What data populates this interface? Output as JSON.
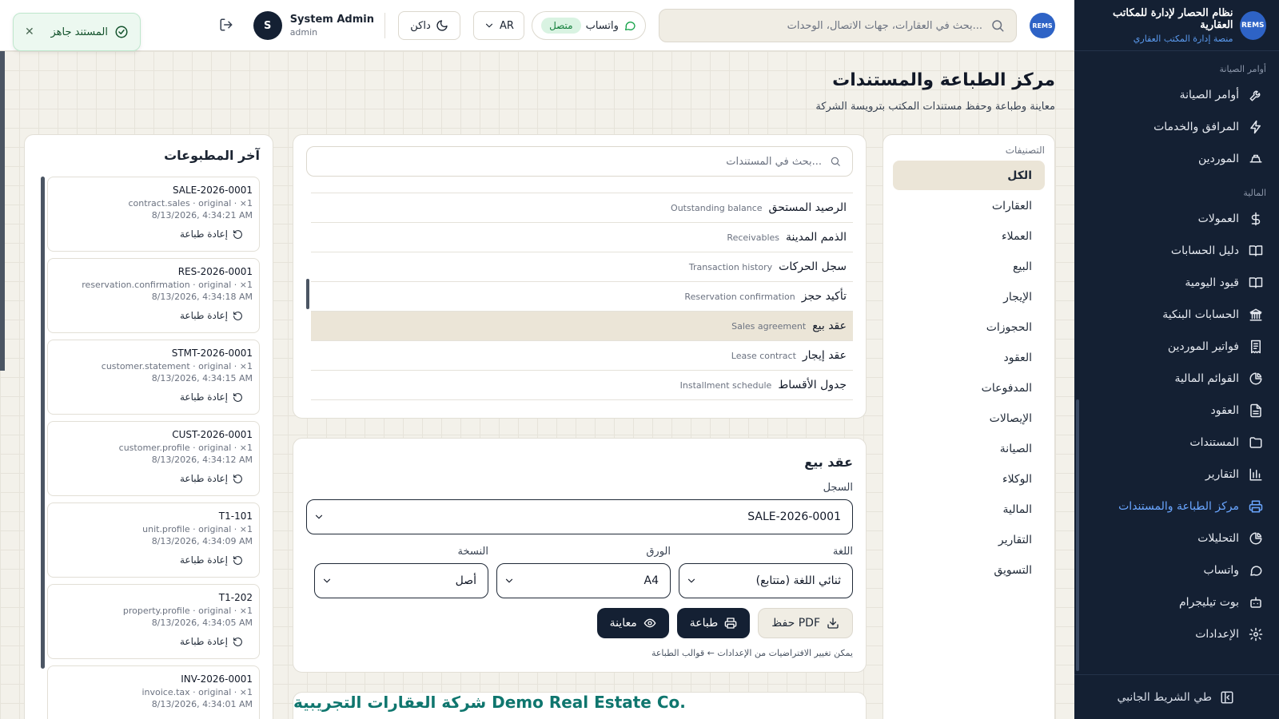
{
  "sidebar": {
    "brand_name": "نظام الحصار لإدارة للمكاتب العقارية",
    "brand_sub": "منصة إدارة المكتب العقاري",
    "logo_text": "REMS",
    "groups": [
      {
        "label": "أوامر الصيانة",
        "items": [
          {
            "label": "أوامر الصيانة",
            "icon": "wrench-icon"
          },
          {
            "label": "المرافق والخدمات",
            "icon": "zap-icon"
          },
          {
            "label": "الموردين",
            "icon": "truck-icon"
          }
        ]
      },
      {
        "label": "المالية",
        "items": [
          {
            "label": "العمولات",
            "icon": "dollar-icon"
          },
          {
            "label": "دليل الحسابات",
            "icon": "book-icon"
          },
          {
            "label": "قيود اليومية",
            "icon": "book-open-icon"
          },
          {
            "label": "الحسابات البنكية",
            "icon": "bank-icon"
          },
          {
            "label": "فواتير الموردين",
            "icon": "receipt-icon"
          },
          {
            "label": "القوائم المالية",
            "icon": "pie-icon"
          },
          {
            "label": "العقود",
            "icon": "file-icon"
          },
          {
            "label": "المستندات",
            "icon": "folder-icon"
          },
          {
            "label": "التقارير",
            "icon": "bar-chart-icon"
          },
          {
            "label": "مركز الطباعة والمستندات",
            "icon": "printer-icon",
            "active": true
          },
          {
            "label": "التحليلات",
            "icon": "pie-icon"
          },
          {
            "label": "واتساب",
            "icon": "message-icon"
          },
          {
            "label": "بوت تيليجرام",
            "icon": "bot-icon"
          },
          {
            "label": "الإعدادات",
            "icon": "gear-icon"
          }
        ]
      }
    ],
    "collapse_label": "طي الشريط الجانبي"
  },
  "topbar": {
    "search_placeholder": "بحث في العقارات، جهات الاتصال، الوحدات...",
    "avatar_text": "REMS",
    "whatsapp_label": "واتساب",
    "whatsapp_status": "متصل",
    "lang_label": "AR",
    "theme_label": "داكن",
    "user_initial": "S",
    "user_name": "System Admin",
    "user_role": "admin"
  },
  "toast": {
    "message": "المستند جاهز"
  },
  "page": {
    "title": "مركز الطباعة والمستندات",
    "subtitle": "معاينة وطباعة وحفظ مستندات المكتب بترويسة الشركة"
  },
  "categories": {
    "heading": "التصنيفات",
    "items": [
      "الكل",
      "العقارات",
      "العملاء",
      "البيع",
      "الإيجار",
      "الحجوزات",
      "العقود",
      "المدفوعات",
      "الإيصالات",
      "الصيانة",
      "الوكلاء",
      "المالية",
      "التقارير",
      "التسويق"
    ],
    "active_index": 0
  },
  "documents": {
    "search_placeholder": "بحث في المستندات...",
    "items": [
      {
        "ar": "الرصيد المستحق",
        "en": "Outstanding balance"
      },
      {
        "ar": "الذمم المدينة",
        "en": "Receivables"
      },
      {
        "ar": "سجل الحركات",
        "en": "Transaction history"
      },
      {
        "ar": "تأكيد حجز",
        "en": "Reservation confirmation"
      },
      {
        "ar": "عقد بيع",
        "en": "Sales agreement",
        "active": true
      },
      {
        "ar": "عقد إيجار",
        "en": "Lease contract"
      },
      {
        "ar": "جدول الأقساط",
        "en": "Installment schedule"
      }
    ]
  },
  "form": {
    "title": "عقد بيع",
    "record_label": "السجل",
    "record_value": "SALE-2026-0001",
    "language_label": "اللغة",
    "language_value": "ثنائي اللغة (متتابع)",
    "paper_label": "الورق",
    "paper_value": "A4",
    "copy_label": "النسخة",
    "copy_value": "أصل",
    "preview_button": "معاينة",
    "print_button": "طباعة",
    "save_pdf_button": "حفظ PDF",
    "hint": "يمكن تغيير الافتراضيات من الإعدادات ← قوالب الطباعة"
  },
  "preview": {
    "company_title": "شركة العقارات التجريبية Demo Real Estate Co."
  },
  "recent": {
    "title": "آخر المطبوعات",
    "reprint_label": "إعادة طباعة",
    "items": [
      {
        "id": "SALE-2026-0001",
        "meta": "contract.sales · original · ×1",
        "date": "8/13/2026, 4:34:21 AM"
      },
      {
        "id": "RES-2026-0001",
        "meta": "reservation.confirmation · original · ×1",
        "date": "8/13/2026, 4:34:18 AM"
      },
      {
        "id": "STMT-2026-0001",
        "meta": "customer.statement · original · ×1",
        "date": "8/13/2026, 4:34:15 AM"
      },
      {
        "id": "CUST-2026-0001",
        "meta": "customer.profile · original · ×1",
        "date": "8/13/2026, 4:34:12 AM"
      },
      {
        "id": "T1-101",
        "meta": "unit.profile · original · ×1",
        "date": "8/13/2026, 4:34:09 AM"
      },
      {
        "id": "T1-202",
        "meta": "property.profile · original · ×1",
        "date": "8/13/2026, 4:34:05 AM"
      },
      {
        "id": "INV-2026-0001",
        "meta": "invoice.tax · original · ×1",
        "date": "8/13/2026, 4:34:01 AM"
      }
    ]
  },
  "colors": {
    "sidebar_bg": "#142033",
    "accent": "#6aa6ff",
    "success": "#16a34a",
    "preview_title": "#0f766e"
  }
}
